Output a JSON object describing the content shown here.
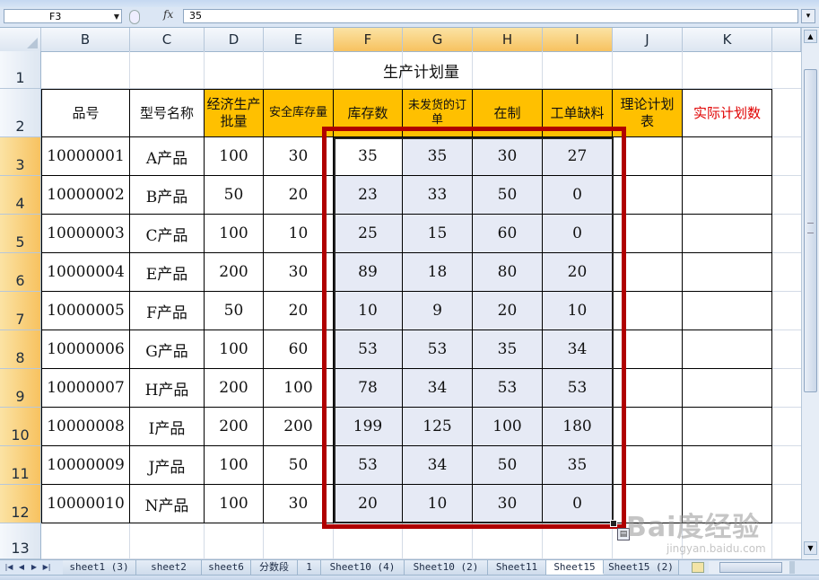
{
  "formula_bar": {
    "name_box": "F3",
    "fx_label": "fx",
    "formula": "35"
  },
  "columns": [
    "B",
    "C",
    "D",
    "E",
    "F",
    "G",
    "H",
    "I",
    "J",
    "K"
  ],
  "rows": [
    "1",
    "2",
    "3",
    "4",
    "5",
    "6",
    "7",
    "8",
    "9",
    "10",
    "11",
    "12",
    "13"
  ],
  "sheet": {
    "title": "生产计划量",
    "headers": [
      "品号",
      "型号名称",
      "经济生产批量",
      "安全库存量",
      "库存数",
      "未发货的订单",
      "在制",
      "工单缺料",
      "理论计划表",
      "实际计划数"
    ],
    "data": [
      [
        "10000001",
        "A产品",
        "100",
        "30",
        "35",
        "35",
        "30",
        "27",
        "",
        ""
      ],
      [
        "10000002",
        "B产品",
        "50",
        "20",
        "23",
        "33",
        "50",
        "0",
        "",
        ""
      ],
      [
        "10000003",
        "C产品",
        "100",
        "10",
        "25",
        "15",
        "60",
        "0",
        "",
        ""
      ],
      [
        "10000004",
        "E产品",
        "200",
        "30",
        "89",
        "18",
        "80",
        "20",
        "",
        ""
      ],
      [
        "10000005",
        "F产品",
        "50",
        "20",
        "10",
        "9",
        "20",
        "10",
        "",
        ""
      ],
      [
        "10000006",
        "G产品",
        "100",
        "60",
        "53",
        "53",
        "35",
        "34",
        "",
        ""
      ],
      [
        "10000007",
        "H产品",
        "200",
        "100",
        "78",
        "34",
        "53",
        "53",
        "",
        ""
      ],
      [
        "10000008",
        "I产品",
        "200",
        "200",
        "199",
        "125",
        "100",
        "180",
        "",
        ""
      ],
      [
        "10000009",
        "J产品",
        "100",
        "50",
        "53",
        "34",
        "50",
        "35",
        "",
        ""
      ],
      [
        "10000010",
        "N产品",
        "100",
        "30",
        "20",
        "10",
        "30",
        "0",
        "",
        ""
      ]
    ]
  },
  "sheet_tabs": [
    "sheet1 (3)",
    "sheet2",
    "sheet6",
    "分数段",
    "1",
    "Sheet10 (4)",
    "Sheet10 (2)",
    "Sheet11",
    "Sheet15",
    "Sheet15 (2)"
  ],
  "active_tab": "Sheet15",
  "watermark": {
    "main": "Bai度经验",
    "sub": "jingyan.baidu.com"
  },
  "colors": {
    "header_orange": "#ffc000",
    "highlight_red": "#b00000",
    "selection_fill": "#e6eaf5",
    "red_text": "#e00000"
  }
}
